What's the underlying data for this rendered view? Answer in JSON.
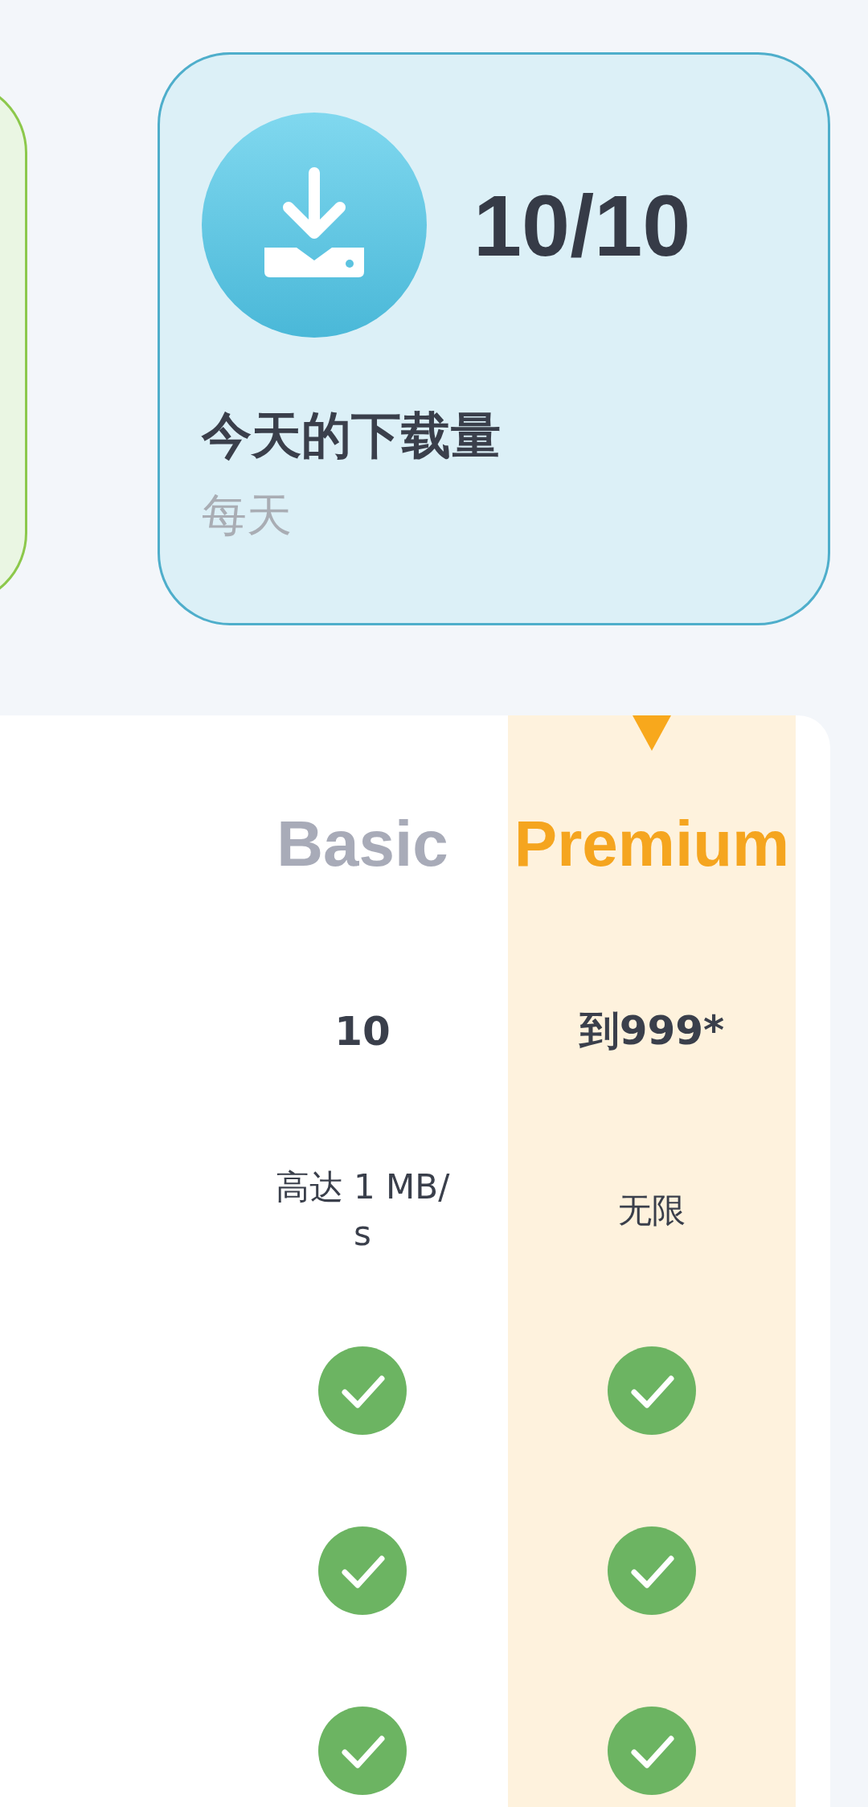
{
  "stat_card": {
    "value": "10/10",
    "title": "今天的下载量",
    "subtitle": "每天"
  },
  "plans": [
    {
      "name": "Basic",
      "selected": false
    },
    {
      "name": "Premium",
      "selected": true
    }
  ],
  "rows": [
    {
      "kind": "value",
      "values": [
        "10",
        "到999*"
      ]
    },
    {
      "kind": "text",
      "values": [
        "高达 1 MB/s",
        "无限"
      ]
    },
    {
      "kind": "check",
      "included": [
        true,
        true
      ]
    },
    {
      "kind": "check",
      "included": [
        true,
        true
      ]
    },
    {
      "kind": "check",
      "included": [
        true,
        true
      ]
    }
  ]
}
